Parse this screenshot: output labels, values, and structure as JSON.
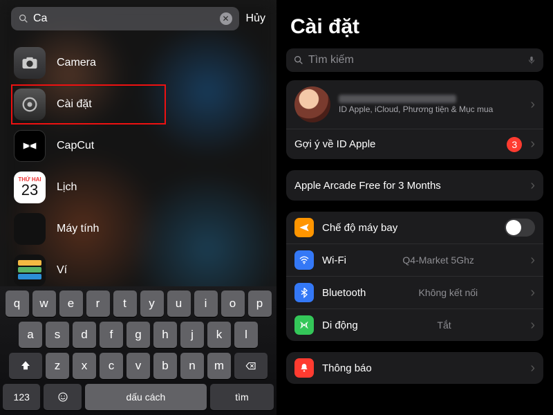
{
  "left": {
    "search_query": "Ca",
    "cancel": "Hủy",
    "results": [
      {
        "name": "Camera"
      },
      {
        "name": "Cài đặt"
      },
      {
        "name": "CapCut"
      },
      {
        "name": "Lịch"
      },
      {
        "name": "Máy tính"
      },
      {
        "name": "Ví"
      }
    ],
    "calendar_day_label": "THỨ HAI",
    "calendar_day_num": "23",
    "keyboard": {
      "rows": [
        [
          "q",
          "w",
          "e",
          "r",
          "t",
          "y",
          "u",
          "i",
          "o",
          "p"
        ],
        [
          "a",
          "s",
          "d",
          "f",
          "g",
          "h",
          "j",
          "k",
          "l"
        ],
        [
          "z",
          "x",
          "c",
          "v",
          "b",
          "n",
          "m"
        ]
      ],
      "num": "123",
      "space": "dấu cách",
      "return": "tìm"
    }
  },
  "right": {
    "title": "Cài đặt",
    "search_placeholder": "Tìm kiếm",
    "profile_sub": "ID Apple, iCloud, Phương tiện & Mục mua",
    "apple_id_suggestion": "Gợi ý về ID Apple",
    "apple_id_badge": "3",
    "arcade": "Apple Arcade Free for 3 Months",
    "rows": {
      "airplane": "Chế độ máy bay",
      "wifi": "Wi-Fi",
      "wifi_val": "Q4-Market 5Ghz",
      "bt": "Bluetooth",
      "bt_val": "Không kết nối",
      "cell": "Di động",
      "cell_val": "Tắt",
      "noti": "Thông báo"
    }
  }
}
